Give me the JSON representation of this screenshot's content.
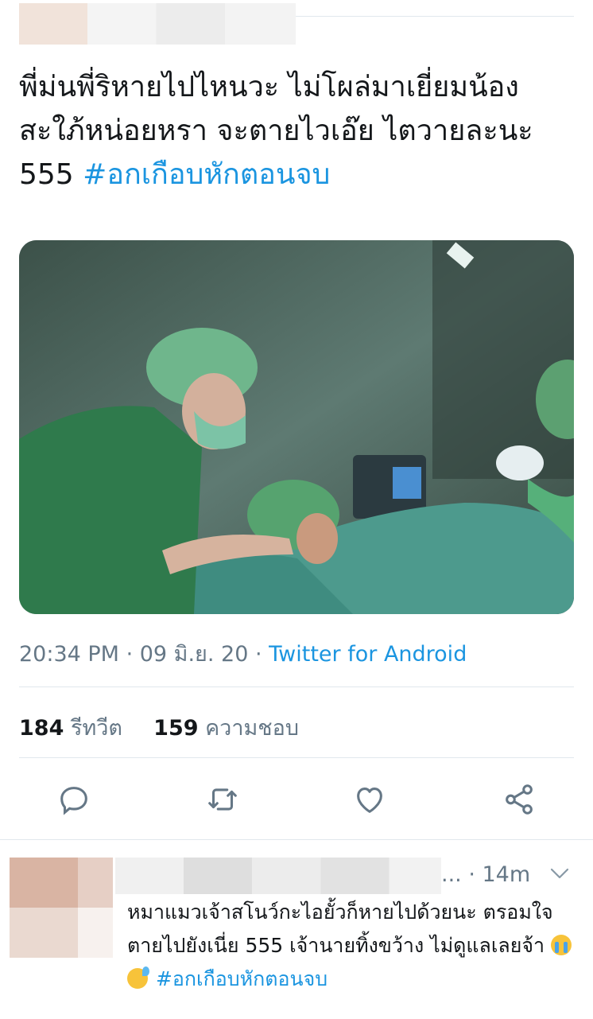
{
  "tweet": {
    "text": "พี่ม่นพี่ริหายไปไหนวะ ไม่โผล่มาเยี่ยมน้องสะใภ้หน่อยหรา จะตายไวเอ๊ย ไตวายละนะ 555 ",
    "hashtag": "#อกเกือบหักตอนจบ",
    "time": "20:34 PM",
    "separator": " · ",
    "date": "09 มิ.ย. 20",
    "source": "Twitter for Android",
    "stats": {
      "retweets_count": "184",
      "retweets_label": "รีทวีต",
      "likes_count": "159",
      "likes_label": "ความชอบ"
    },
    "media_icon": "photo"
  },
  "actions": [
    "reply-icon",
    "retweet-icon",
    "like-icon",
    "share-icon"
  ],
  "reply": {
    "handle_suffix": "...",
    "time": "· 14m",
    "text": "หมาแมวเจ้าสโนว์กะไอยั้วก็หายไปด้วยนะ ตรอมใจตายไปยังเนี่ย 555 เจ้านายทิ้งขว้าง ไม่ดูแลเลยจ้า ",
    "emoji": [
      "loudly-crying-face",
      "grinning-face-with-sweat"
    ],
    "hashtag": "#อกเกือบหักตอนจบ"
  },
  "colors": {
    "accent": "#1b95e0",
    "text": "#14171a",
    "secondary": "#657786",
    "divider": "#e1e8ed"
  }
}
